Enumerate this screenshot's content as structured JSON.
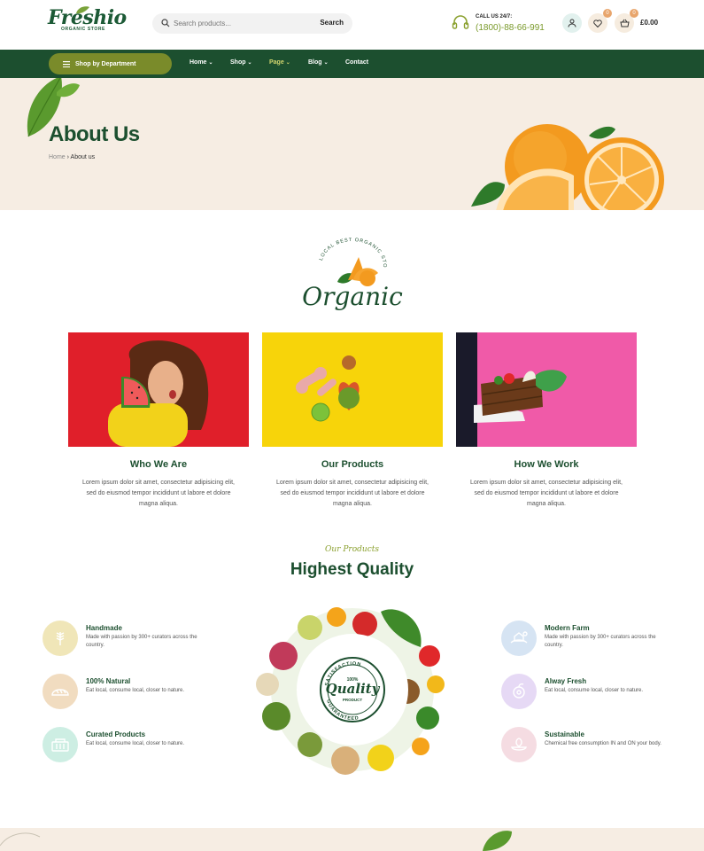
{
  "brand": {
    "name": "Freshio",
    "tagline": "ORGANIC STORE"
  },
  "search": {
    "placeholder": "Search products...",
    "button": "Search"
  },
  "contact": {
    "label": "CALL US 24/7:",
    "phone": "(1800)-88-66-991"
  },
  "header_actions": {
    "wishlist_count": "0",
    "cart_count": "0",
    "cart_total": "£0.00"
  },
  "nav": {
    "department": "Shop by Department",
    "items": [
      {
        "label": "Home",
        "caret": "⌄"
      },
      {
        "label": "Shop",
        "caret": "⌄"
      },
      {
        "label": "Page",
        "caret": "⌄",
        "active": true
      },
      {
        "label": "Blog",
        "caret": "⌄"
      },
      {
        "label": "Contact",
        "caret": ""
      }
    ]
  },
  "hero": {
    "title": "About Us",
    "breadcrumb_home": "Home",
    "breadcrumb_sep": "›",
    "breadcrumb_current": "About us"
  },
  "emblem": {
    "arc_text": "LOCAL BEST ORGANIC STORE",
    "script": "Organic"
  },
  "cards": [
    {
      "title": "Who We Are",
      "text": "Lorem ipsum dolor sit amet, consectetur adipisicing elit, sed do eiusmod tempor incididunt ut labore et dolore magna aliqua."
    },
    {
      "title": "Our Products",
      "text": "Lorem ipsum dolor sit amet, consectetur adipisicing elit, sed do eiusmod tempor incididunt ut labore et dolore magna aliqua."
    },
    {
      "title": "How We Work",
      "text": "Lorem ipsum dolor sit amet, consectetur adipisicing elit, sed do eiusmod tempor incididunt ut labore et dolore magna aliqua."
    }
  ],
  "quality": {
    "subtitle": "Our Products",
    "title": "Highest Quality",
    "seal": {
      "top": "SATISFACTION",
      "middle_top": "100%",
      "word": "Quality",
      "middle_bottom": "PRODUCT",
      "bottom": "GUARANTEED"
    },
    "left_features": [
      {
        "title": "Handmade",
        "desc": "Made with passion by 300+ curators across the country.",
        "icon": "wheat-icon",
        "color": "#f0e6b8"
      },
      {
        "title": "100% Natural",
        "desc": "Eat local, consume local, closer to nature.",
        "icon": "bread-icon",
        "color": "#f1dcc0"
      },
      {
        "title": "Curated Products",
        "desc": "Eat local, consume local, closer to nature.",
        "icon": "basket-icon",
        "color": "#cdeee3"
      }
    ],
    "right_features": [
      {
        "title": "Modern Farm",
        "desc": "Made with passion by 300+ curators across the country.",
        "icon": "farm-icon",
        "color": "#d6e4f3"
      },
      {
        "title": "Alway Fresh",
        "desc": "Eat local, consume local, closer to nature.",
        "icon": "fresh-icon",
        "color": "#e6d9f5"
      },
      {
        "title": "Sustainable",
        "desc": "Chemical free consumption IN and ON your body.",
        "icon": "sustainable-icon",
        "color": "#f5dce2"
      }
    ]
  },
  "colors": {
    "primary": "#1c4f2f",
    "accent": "#7a8b2a",
    "hero_bg": "#f6ede3"
  }
}
